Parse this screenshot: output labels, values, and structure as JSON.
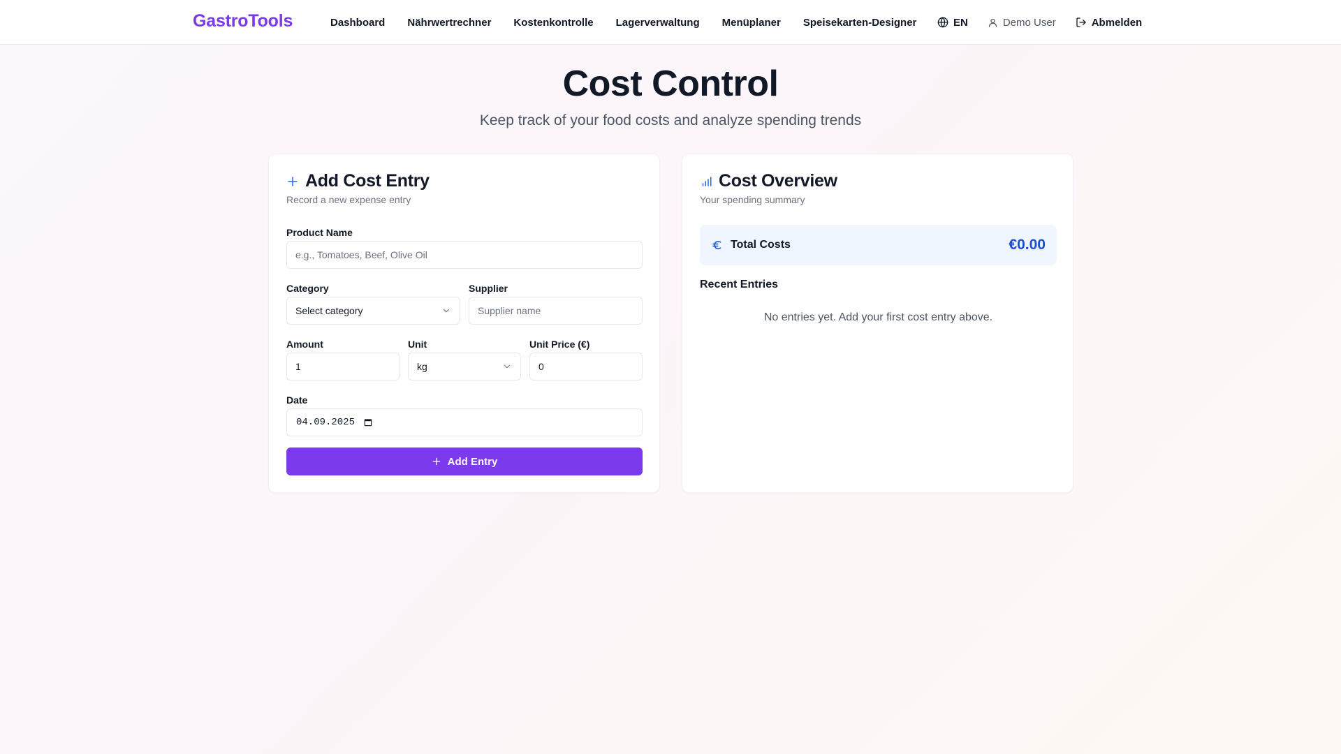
{
  "header": {
    "logo": "GastroTools",
    "nav": [
      "Dashboard",
      "Nährwertrechner",
      "Kostenkontrolle",
      "Lagerverwaltung",
      "Menüplaner",
      "Speisekarten-Designer"
    ],
    "language": "EN",
    "user": "Demo User",
    "logout": "Abmelden"
  },
  "hero": {
    "title": "Cost Control",
    "subtitle": "Keep track of your food costs and analyze spending trends"
  },
  "add_entry": {
    "title": "Add Cost Entry",
    "description": "Record a new expense entry",
    "product_label": "Product Name",
    "product_placeholder": "e.g., Tomatoes, Beef, Olive Oil",
    "category_label": "Category",
    "category_value": "Select category",
    "supplier_label": "Supplier",
    "supplier_placeholder": "Supplier name",
    "amount_label": "Amount",
    "amount_value": "1",
    "unit_label": "Unit",
    "unit_value": "kg",
    "unit_price_label": "Unit Price (€)",
    "unit_price_value": "0",
    "date_label": "Date",
    "date_value": "04.09.2025",
    "submit_label": "Add Entry"
  },
  "overview": {
    "title": "Cost Overview",
    "description": "Your spending summary",
    "total_label": "Total Costs",
    "total_value": "€0.00",
    "recent_title": "Recent Entries",
    "empty_text": "No entries yet. Add your first cost entry above."
  },
  "colors": {
    "brand": "#7c3aed",
    "accent_blue": "#1d4ed8",
    "total_bg": "#eff6ff"
  },
  "icons": {
    "language": "globe-icon",
    "user": "user-icon",
    "logout": "logout-icon",
    "add_entry": "plus-icon",
    "overview": "bar-chart-icon",
    "total": "euro-icon",
    "select": "chevron-down-icon",
    "date": "calendar-icon"
  }
}
